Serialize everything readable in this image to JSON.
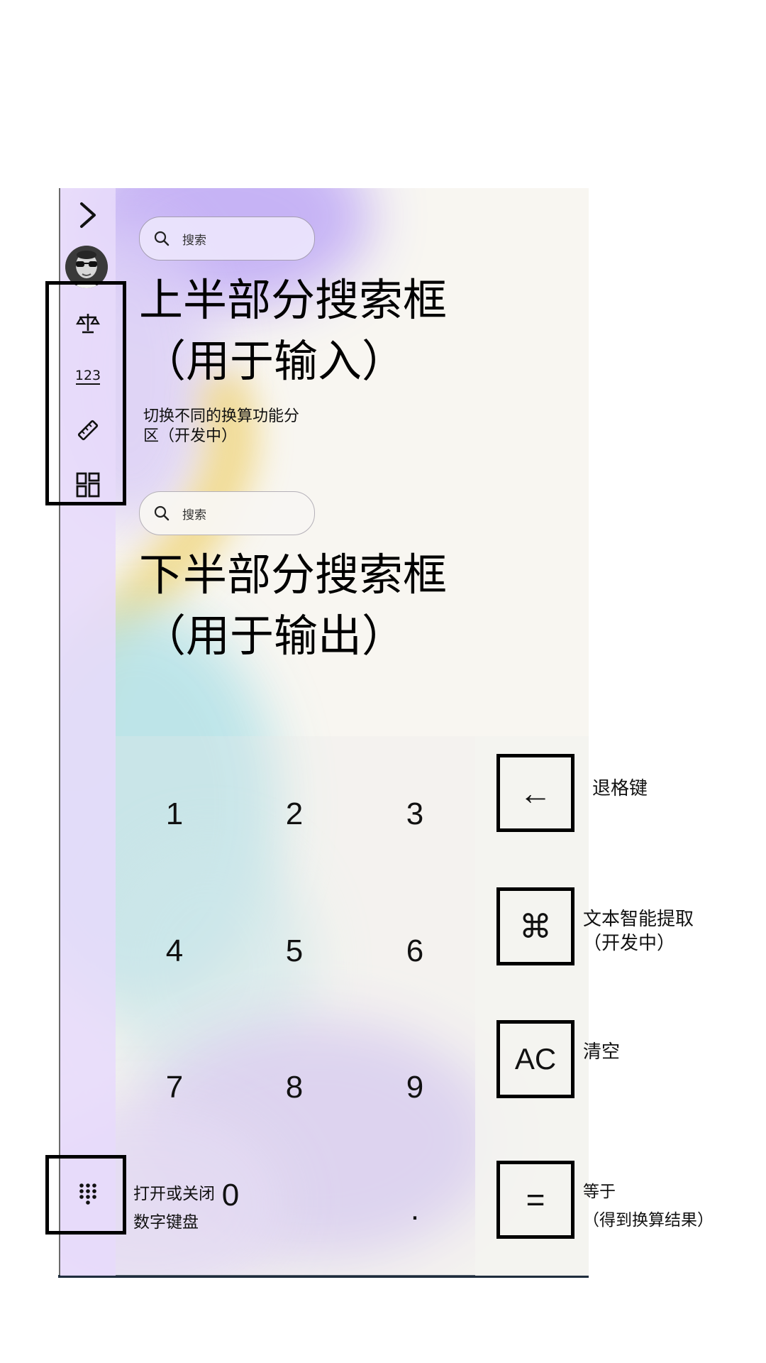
{
  "search": {
    "upper_placeholder": "搜索",
    "lower_placeholder": "搜索"
  },
  "annotations": {
    "upper_title_line1": "上半部分搜索框",
    "upper_title_line2": "（用于输入）",
    "switch_line1": "切换不同的换算功能分",
    "switch_line2": "区（开发中）",
    "lower_title_line1": "下半部分搜索框",
    "lower_title_line2": "（用于输出）",
    "backspace": "退格键",
    "smart_extract_line1": "文本智能提取",
    "smart_extract_line2": "（开发中）",
    "clear": "清空",
    "equals_line1": "等于",
    "equals_line2": "（得到换算结果）",
    "numpad_toggle_line1": "打开或关闭",
    "numpad_toggle_line2": "数字键盘"
  },
  "keypad": {
    "k1": "1",
    "k2": "2",
    "k3": "3",
    "k4": "4",
    "k5": "5",
    "k6": "6",
    "k7": "7",
    "k8": "8",
    "k9": "9",
    "k0": "0",
    "dot": ".",
    "backspace": "←",
    "command": "⌘",
    "clear": "AC",
    "equals": "="
  },
  "icons": {
    "expand": "chevron-right-icon",
    "avatar": "avatar",
    "scale": "scale-icon",
    "numbers": "numbers-123-icon",
    "ruler": "ruler-icon",
    "dashboard": "dashboard-icon",
    "dialpad": "dialpad-icon",
    "search": "search-icon"
  },
  "colors": {
    "sidebar": "#e7dbfa",
    "canvas": "#f8f6f1",
    "purple_blob": "#c7b4f5",
    "yellow_blob": "#f3dc87",
    "cyan_blob": "#bfe7ea"
  }
}
